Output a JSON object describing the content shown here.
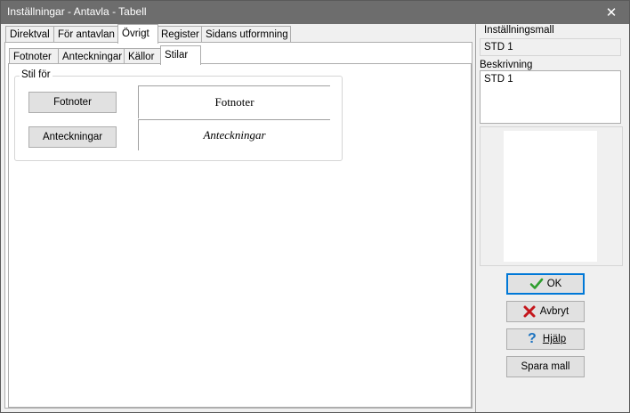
{
  "window": {
    "title": "Inställningar - Antavla - Tabell"
  },
  "top_tabs": [
    {
      "label": "Direktval"
    },
    {
      "label": "För antavlan"
    },
    {
      "label": "Övrigt"
    },
    {
      "label": "Register"
    },
    {
      "label": "Sidans utformning"
    }
  ],
  "sub_tabs": [
    {
      "label": "Fotnoter"
    },
    {
      "label": "Anteckningar"
    },
    {
      "label": "Källor"
    },
    {
      "label": "Stilar"
    }
  ],
  "stil_for": {
    "legend": "Stil för",
    "fotnoter_button": "Fotnoter",
    "fotnoter_preview": "Fotnoter",
    "anteckningar_button": "Anteckningar",
    "anteckningar_preview": "Anteckningar"
  },
  "sidebar": {
    "template_label": "Inställningsmall",
    "template_value": "STD 1",
    "description_label": "Beskrivning",
    "description_value": "STD 1"
  },
  "actions": {
    "ok": "OK",
    "cancel": "Avbryt",
    "help": "Hjälp",
    "save_template": "Spara mall"
  },
  "colors": {
    "titlebar": "#6d6d6d",
    "ok_check": "#2e9e2e",
    "cancel_x": "#c4161c",
    "help": "#1b72c0"
  },
  "icons": {
    "ok": "checkmark-icon",
    "cancel": "red-x-icon",
    "help": "question-mark-icon",
    "close": "close-icon"
  }
}
